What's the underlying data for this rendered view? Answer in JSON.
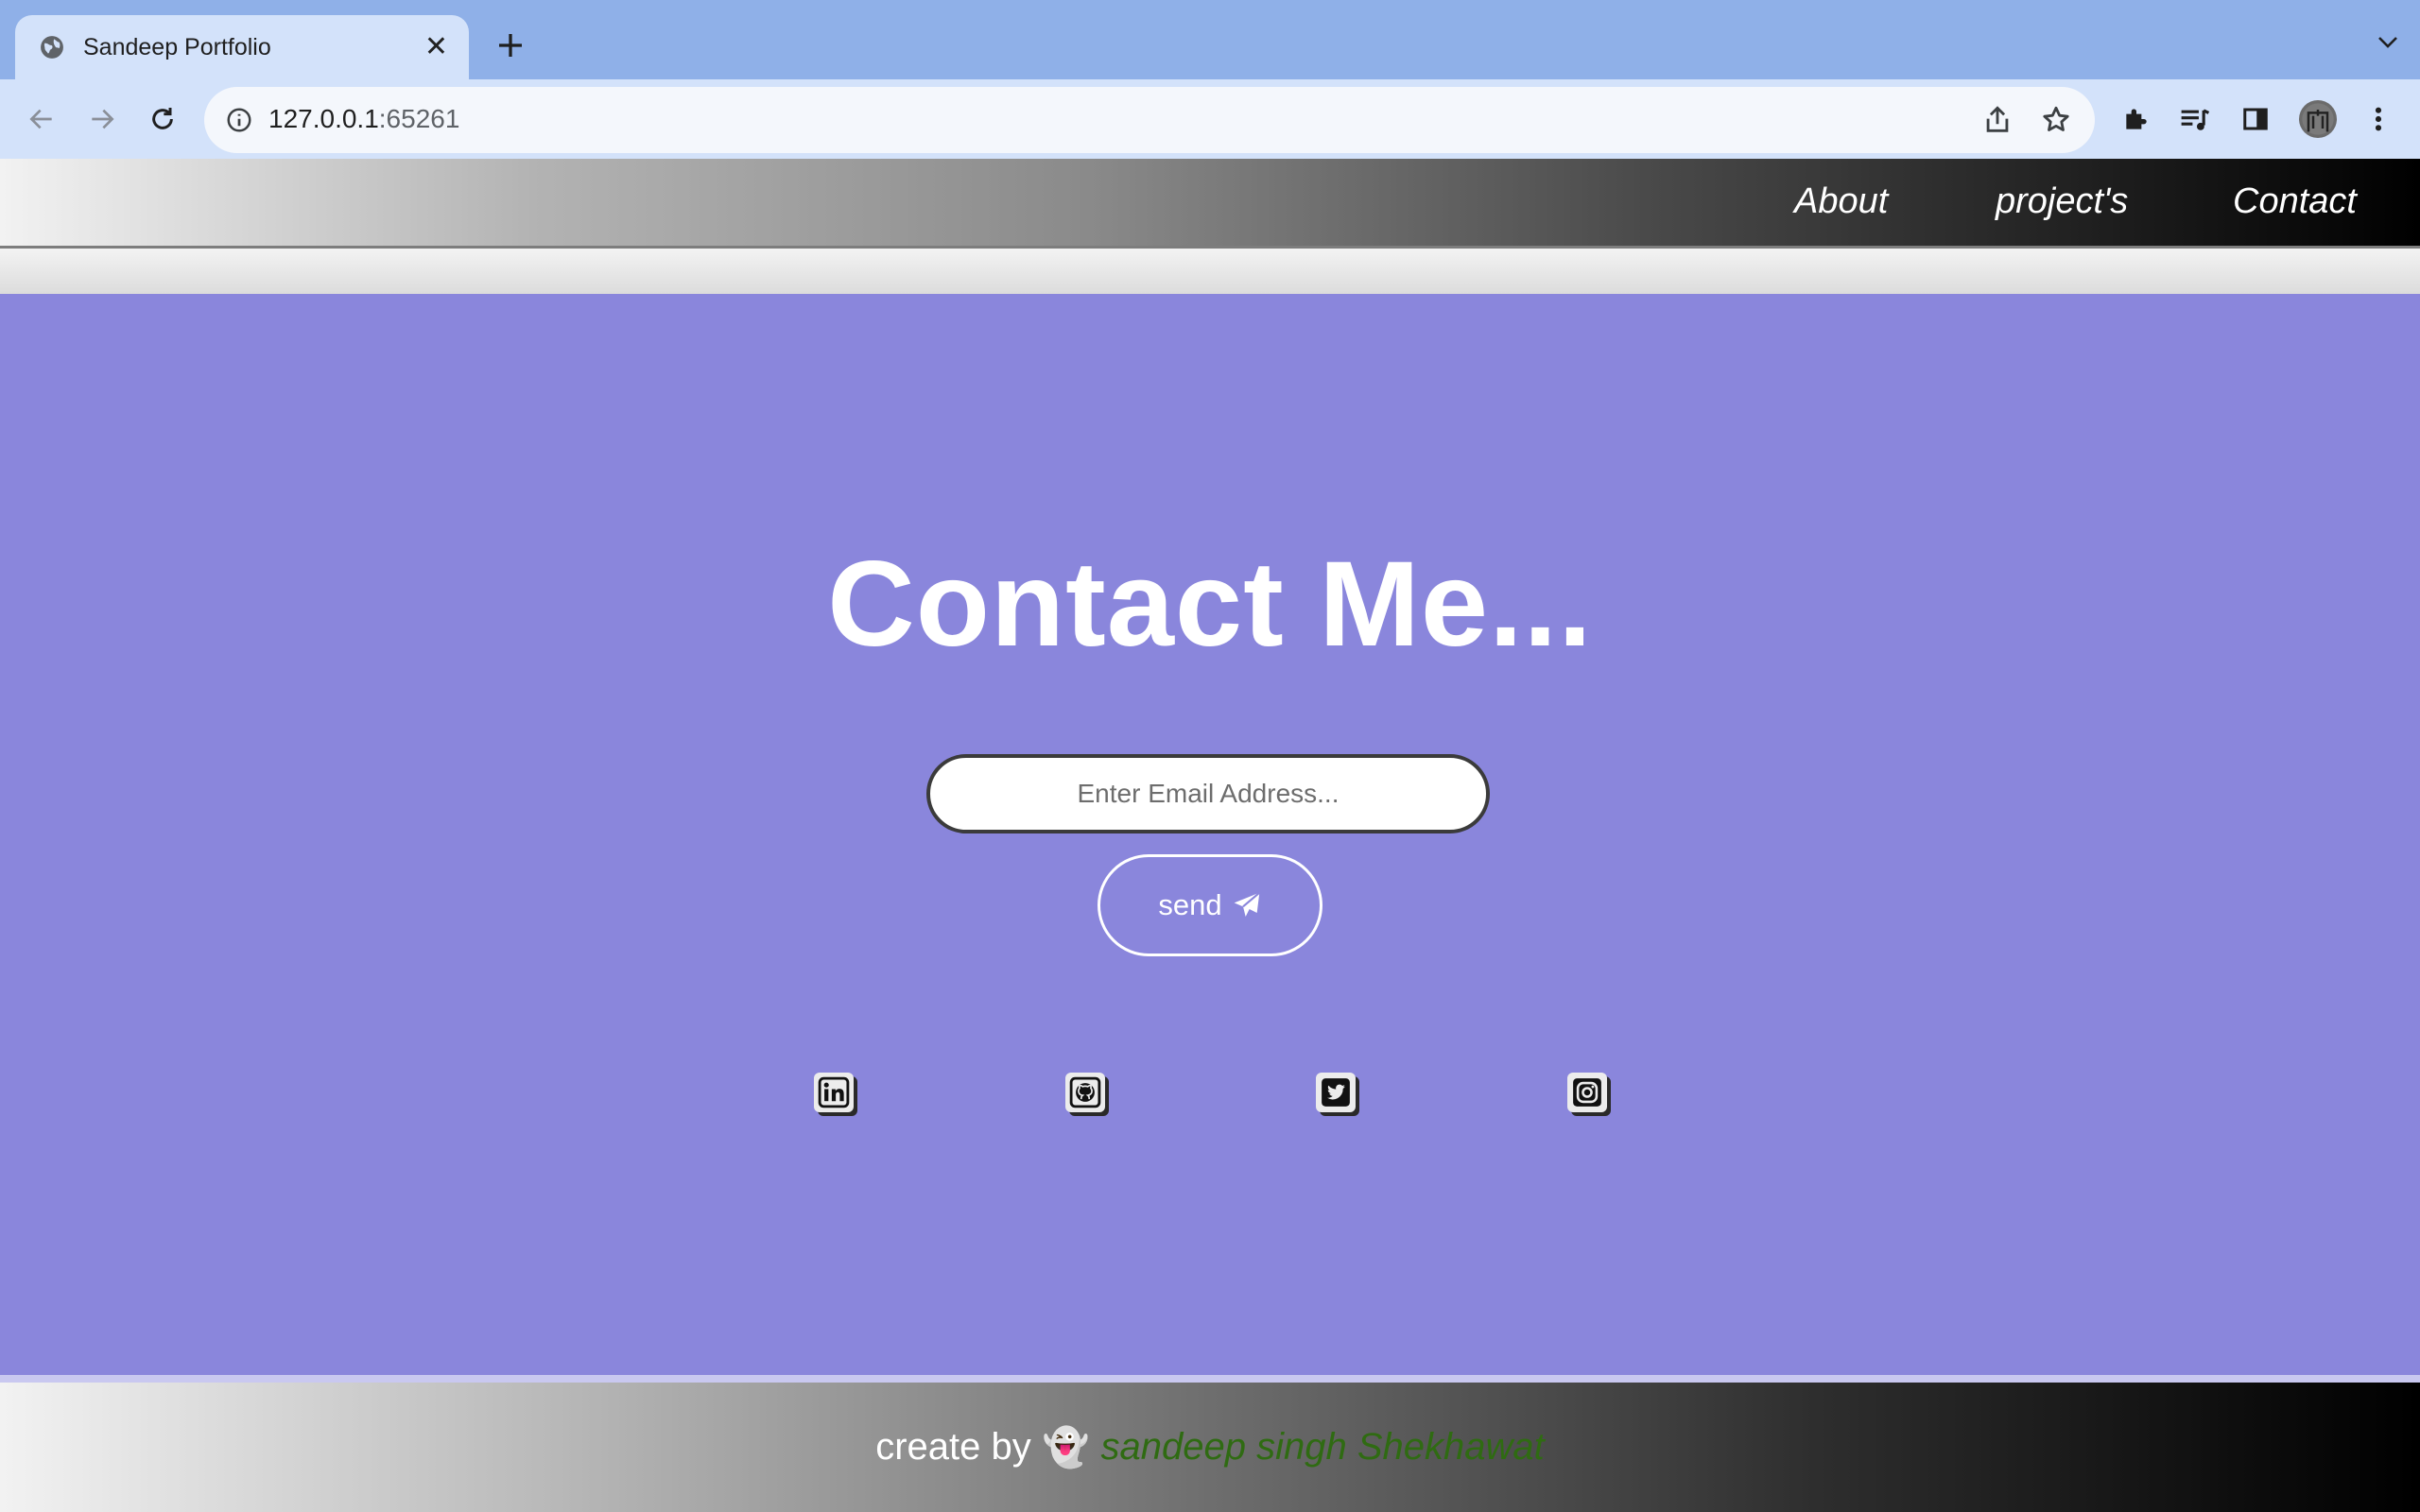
{
  "browser": {
    "tab_title": "Sandeep Portfolio",
    "url_host": "127.0.0.1",
    "url_port": ":65261"
  },
  "nav": {
    "about": "About",
    "projects": "project's",
    "contact": "Contact"
  },
  "contact": {
    "heading": "Contact Me...",
    "email_placeholder": "Enter Email Address...",
    "send_label": "send"
  },
  "social": [
    "linkedin-icon",
    "github-icon",
    "twitter-icon",
    "instagram-icon"
  ],
  "footer": {
    "prefix": "create by",
    "emoji": "👻",
    "author": "sandeep singh Shekhawat"
  },
  "colors": {
    "page_bg": "#8a86dc",
    "tabbar_bg": "#8fb0e8",
    "toolbar_bg": "#d3e2fa",
    "author_green": "#2f6b12"
  }
}
